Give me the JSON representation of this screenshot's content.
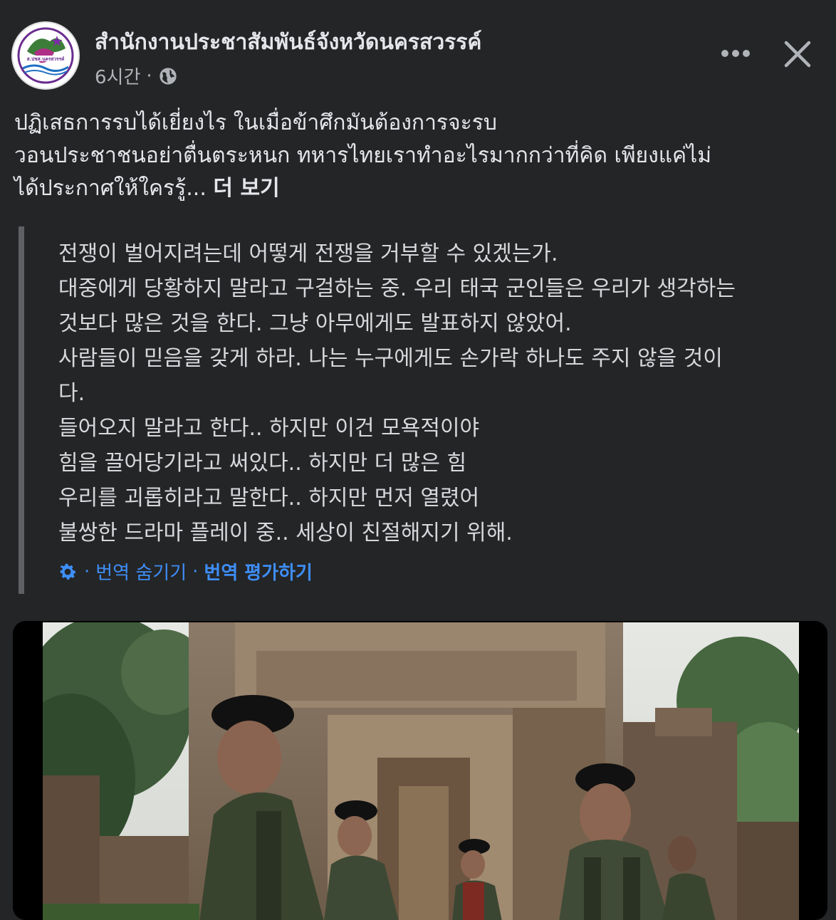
{
  "post": {
    "page_name": "สำนักงานประชาสัมพันธ์จังหวัดนครสวรรค์",
    "time": "6시간",
    "dot": "·",
    "avatar_text": "ส.ปชส.นครสวรรค์",
    "text_lines": [
      "ปฏิเสธการรบได้เยี่ยงไร ในเมื่อข้าศึกมันต้องการจะรบ",
      "วอนประชาชนอย่าตื่นตระหนก ทหารไทยเราทำอะไรมากกว่าที่คิด เพียงแค่ไม่",
      "ได้ประกาศให้ใครรู้..."
    ],
    "see_more": "더 보기"
  },
  "translation": {
    "lines": [
      "전쟁이 벌어지려는데 어떻게 전쟁을 거부할 수 있겠는가.",
      "대중에게 당황하지 말라고 구걸하는 중. 우리 태국 군인들은 우리가 생각하는",
      "것보다 많은 것을 한다. 그냥 아무에게도 발표하지 않았어.",
      "사람들이 믿음을 갖게 하라. 나는 누구에게도 손가락 하나도 주지 않을 것이",
      "다.",
      "들어오지 말라고 한다.. 하지만 이건 모욕적이야",
      "힘을 끌어당기라고 써있다.. 하지만 더 많은 힘",
      "우리를 괴롭히라고 말한다.. 하지만 먼저 열렸어",
      "불쌍한 드라마 플레이 중.. 세상이 친절해지기 위해."
    ],
    "hide_label": "번역 숨기기",
    "rate_label": "번역 평가하기",
    "separator": "·"
  },
  "icons": {
    "more": "more-horizontal-icon",
    "close": "close-icon",
    "globe": "globe-icon",
    "gear": "gear-icon"
  },
  "colors": {
    "background": "#242526",
    "text": "#e4e6eb",
    "secondary": "#b0b3b8",
    "link": "#3e8ef7",
    "quote_bar": "#5e6064"
  }
}
